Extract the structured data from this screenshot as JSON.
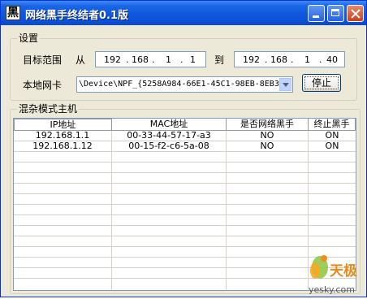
{
  "window": {
    "title": "网络黑手终结者0.1版",
    "app_icon_glyph": "黑"
  },
  "settings": {
    "legend": "设置",
    "target_range_label": "目标范围",
    "from_label": "从",
    "to_label": "到",
    "start_ip": [
      "192",
      "168",
      "1",
      "1"
    ],
    "end_ip": [
      "192",
      "168",
      "1",
      "40"
    ],
    "adapter_label": "本地网卡",
    "adapter_value": "\\Device\\NPF_{5258A984-66E1-45C1-98EB-8EB3",
    "stop_button": "停止"
  },
  "hosts": {
    "legend": "混杂模式主机",
    "columns": [
      "IP地址",
      "MAC地址",
      "是否网络黑手",
      "终止黑手"
    ],
    "rows": [
      [
        "192.168.1.1",
        "00-33-44-57-17-a3",
        "NO",
        "ON"
      ],
      [
        "192.168.1.12",
        "00-15-f2-c6-5a-08",
        "NO",
        "ON"
      ]
    ]
  },
  "watermark": {
    "brand": "天极",
    "domain": "yesky.com"
  },
  "colors": {
    "titlebar": "#0a4bd0",
    "window_bg": "#ece9d8",
    "input_border": "#7f9db9"
  }
}
